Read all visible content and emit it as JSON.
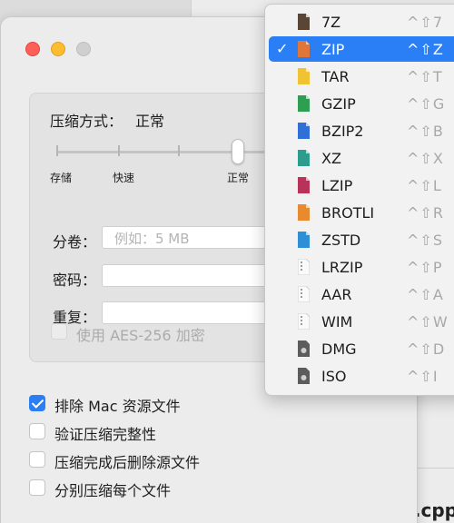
{
  "background_window": {
    "label": "n.cpp"
  },
  "dialog": {
    "compression": {
      "label": "压缩方式：",
      "value": "正常"
    },
    "slider": {
      "labels": [
        "存储",
        "快速",
        "正常"
      ],
      "level": 3,
      "steps": 5
    },
    "split": {
      "label": "分卷：",
      "placeholder": "例如：5 MB"
    },
    "password": {
      "label": "密码：",
      "value": ""
    },
    "repeat": {
      "label": "重复：",
      "value": ""
    },
    "aes": {
      "label": "使用 AES-256 加密",
      "checked": false,
      "enabled": false
    },
    "options": [
      {
        "label": "排除 Mac 资源文件",
        "checked": true
      },
      {
        "label": "验证压缩完整性",
        "checked": false
      },
      {
        "label": "压缩完成后删除源文件",
        "checked": false
      },
      {
        "label": "分别压缩每个文件",
        "checked": false
      }
    ]
  },
  "format_menu": {
    "selected": "ZIP",
    "items": [
      {
        "label": "7Z",
        "shortcut": "^⇧7",
        "icon": "7z-file-icon",
        "color": "#5a4636"
      },
      {
        "label": "ZIP",
        "shortcut": "^⇧Z",
        "icon": "zip-file-icon",
        "color": "#e0763a"
      },
      {
        "label": "TAR",
        "shortcut": "^⇧T",
        "icon": "tar-file-icon",
        "color": "#f1c232"
      },
      {
        "label": "GZIP",
        "shortcut": "^⇧G",
        "icon": "gzip-file-icon",
        "color": "#2e9e52"
      },
      {
        "label": "BZIP2",
        "shortcut": "^⇧B",
        "icon": "bzip2-file-icon",
        "color": "#2f6fd6"
      },
      {
        "label": "XZ",
        "shortcut": "^⇧X",
        "icon": "xz-file-icon",
        "color": "#2c9c8c"
      },
      {
        "label": "LZIP",
        "shortcut": "^⇧L",
        "icon": "lzip-file-icon",
        "color": "#b8325a"
      },
      {
        "label": "BROTLI",
        "shortcut": "^⇧R",
        "icon": "brotli-file-icon",
        "color": "#e88a2e"
      },
      {
        "label": "ZSTD",
        "shortcut": "^⇧S",
        "icon": "zstd-file-icon",
        "color": "#2f8fd6"
      },
      {
        "label": "LRZIP",
        "shortcut": "^⇧P",
        "icon": "lrzip-file-icon",
        "color": "#d6d6d6"
      },
      {
        "label": "AAR",
        "shortcut": "^⇧A",
        "icon": "aar-file-icon",
        "color": "#d6d6d6"
      },
      {
        "label": "WIM",
        "shortcut": "^⇧W",
        "icon": "wim-file-icon",
        "color": "#d6d6d6"
      },
      {
        "label": "DMG",
        "shortcut": "^⇧D",
        "icon": "dmg-file-icon",
        "color": "#5c5c5c"
      },
      {
        "label": "ISO",
        "shortcut": "^⇧I",
        "icon": "iso-file-icon",
        "color": "#5c5c5c"
      }
    ]
  }
}
